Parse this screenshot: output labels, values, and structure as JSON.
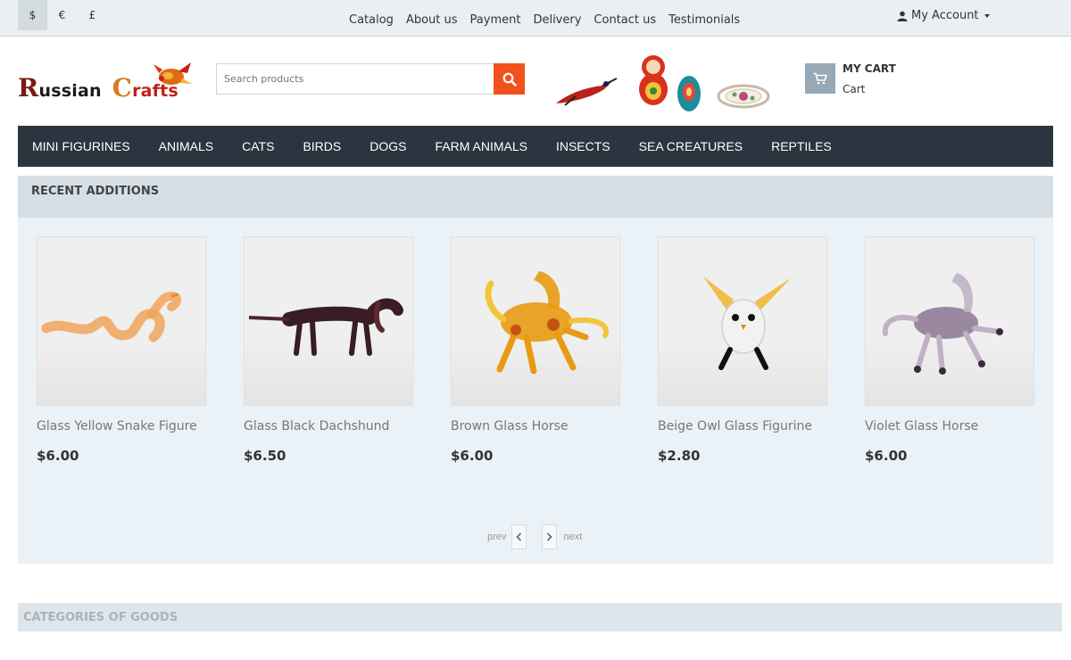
{
  "currencies": [
    {
      "symbol": "$",
      "active": true
    },
    {
      "symbol": "€",
      "active": false
    },
    {
      "symbol": "£",
      "active": false
    }
  ],
  "top_nav": [
    "Catalog",
    "About us",
    "Payment",
    "Delivery",
    "Contact us",
    "Testimonials"
  ],
  "account": {
    "label": "My Account",
    "icon": "user-icon"
  },
  "logo": {
    "word1_first": "R",
    "word1_rest": "ussian",
    "word2_first": "C",
    "word2_rest": "rafts"
  },
  "search": {
    "placeholder": "Search products",
    "icon": "search-icon"
  },
  "cart": {
    "title": "MY CART",
    "subtitle": "Cart",
    "icon": "cart-icon"
  },
  "main_nav": [
    "MINI FIGURINES",
    "ANIMALS",
    "CATS",
    "BIRDS",
    "DOGS",
    "FARM ANIMALS",
    "INSECTS",
    "SEA CREATURES",
    "REPTILES"
  ],
  "recent": {
    "title": "RECENT ADDITIONS",
    "products": [
      {
        "name": "Glass Yellow Snake Figure",
        "price": "$6.00",
        "image": "snake"
      },
      {
        "name": "Glass Black Dachshund",
        "price": "$6.50",
        "image": "dachshund"
      },
      {
        "name": "Brown Glass Horse",
        "price": "$6.00",
        "image": "horse-amber"
      },
      {
        "name": "Beige Owl Glass Figurine",
        "price": "$2.80",
        "image": "owl"
      },
      {
        "name": "Violet Glass Horse",
        "price": "$6.00",
        "image": "horse-violet"
      }
    ],
    "pager": {
      "prev": "prev",
      "next": "next"
    }
  },
  "categories": {
    "title": "CATEGORIES OF GOODS"
  },
  "colors": {
    "accent": "#f0511d",
    "nav_bg": "#2b3540",
    "panel_bg": "#eaf1f7"
  }
}
